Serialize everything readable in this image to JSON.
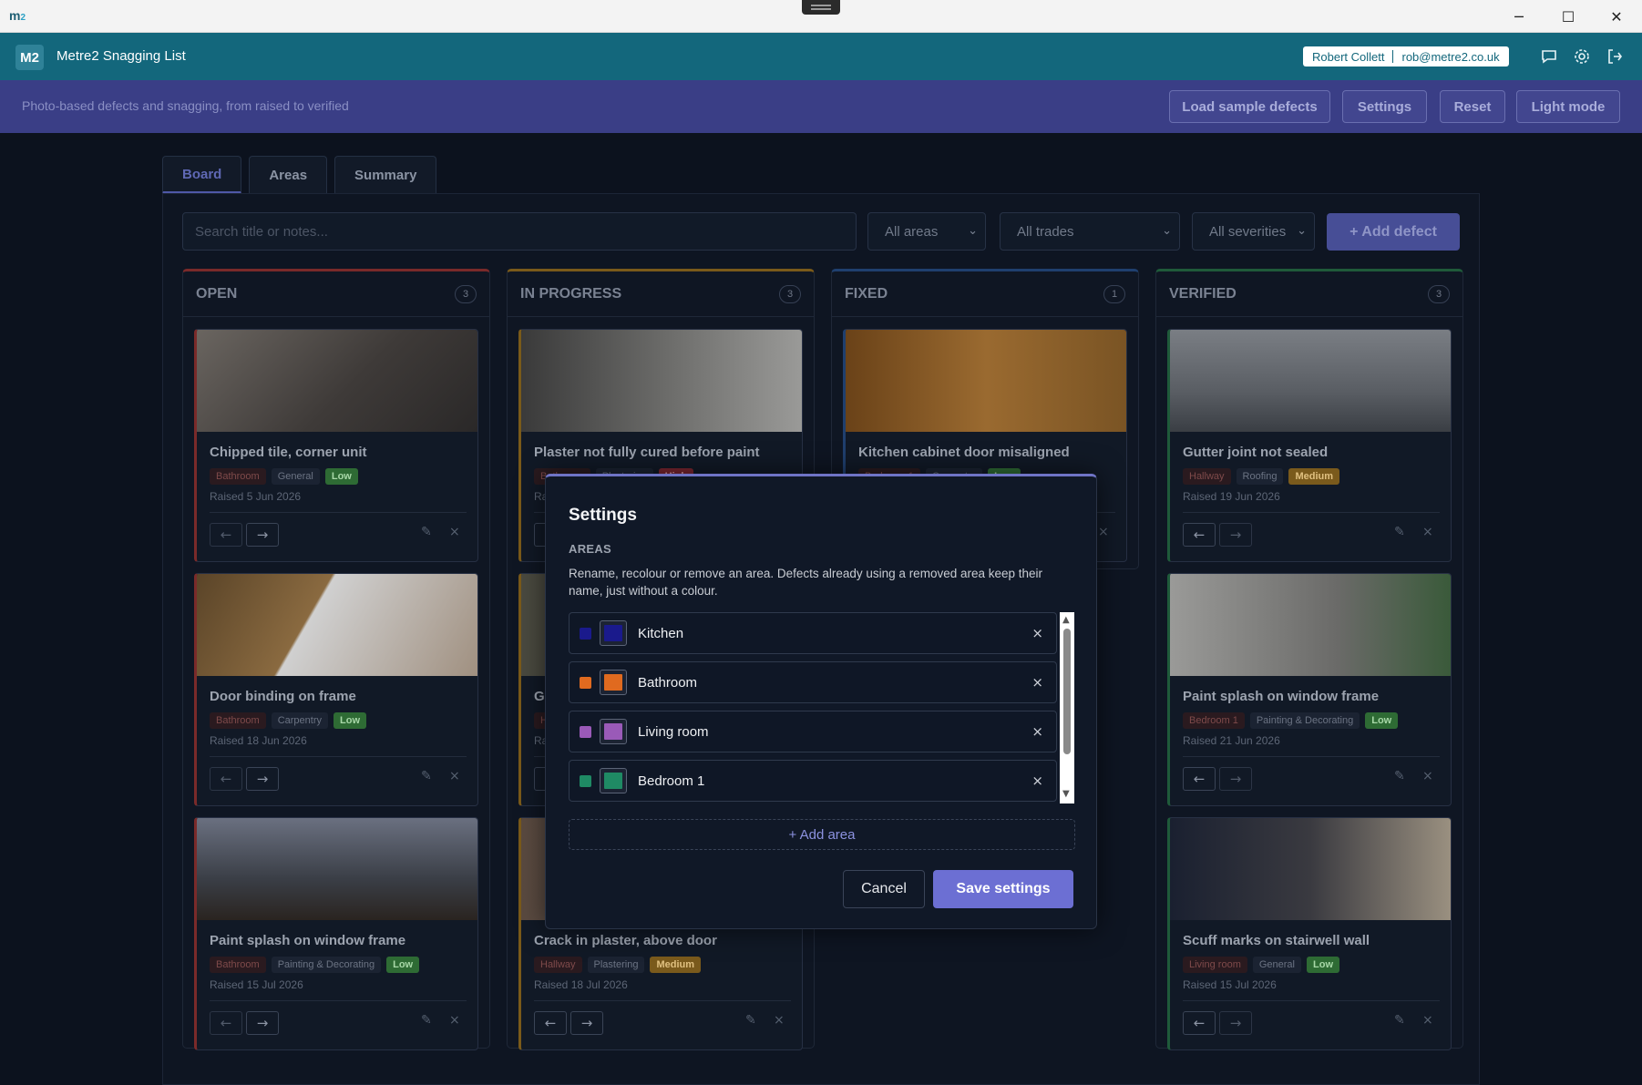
{
  "window": {
    "logo_main": "m",
    "logo_sub": "2",
    "min": "─",
    "max": "☐",
    "close": "✕"
  },
  "app": {
    "badge": "M2",
    "title": "Metre2 Snagging List",
    "user_name": "Robert Collett",
    "user_email": "rob@metre2.co.uk"
  },
  "subbar": {
    "tagline": "Photo-based defects and snagging, from raised to verified",
    "load_sample": "Load sample defects",
    "settings": "Settings",
    "reset": "Reset",
    "light_mode": "Light mode"
  },
  "tabs": [
    "Board",
    "Areas",
    "Summary"
  ],
  "filters": {
    "search_placeholder": "Search title or notes...",
    "areas": "All areas",
    "trades": "All trades",
    "severities": "All severities",
    "add_defect": "+ Add defect"
  },
  "columns": [
    {
      "name": "OPEN",
      "count": "3",
      "accent": "#7a2a2a",
      "cards": [
        {
          "title": "Chipped tile, corner unit",
          "area": "Bathroom",
          "trade": "General",
          "severity": "Low",
          "raised": "Raised 5 Jun 2026"
        },
        {
          "title": "Door binding on frame",
          "area": "Bathroom",
          "trade": "Carpentry",
          "severity": "Low",
          "raised": "Raised 18 Jun 2026"
        },
        {
          "title": "Paint splash on window frame",
          "area": "Bathroom",
          "trade": "Painting & Decorating",
          "severity": "Low",
          "raised": "Raised 15 Jul 2026"
        }
      ]
    },
    {
      "name": "IN PROGRESS",
      "count": "3",
      "accent": "#7a5a1a",
      "cards": [
        {
          "title": "Plaster not fully cured before paint",
          "area": "Bathroom",
          "trade": "Plastering",
          "severity": "High",
          "raised": "Raised"
        },
        {
          "title": "Gr",
          "area": "H",
          "trade": "",
          "severity": "",
          "raised": "Ra"
        },
        {
          "title": "Crack in plaster, above door",
          "area": "Hallway",
          "trade": "Plastering",
          "severity": "Medium",
          "raised": "Raised 18 Jul 2026"
        }
      ]
    },
    {
      "name": "FIXED",
      "count": "1",
      "accent": "#1f3f6e",
      "cards": [
        {
          "title": "Kitchen cabinet door misaligned",
          "area": "Bedroom 1",
          "trade": "Carpentry",
          "severity": "Low",
          "raised": ""
        }
      ]
    },
    {
      "name": "VERIFIED",
      "count": "3",
      "accent": "#1f5a3a",
      "cards": [
        {
          "title": "Gutter joint not sealed",
          "area": "Hallway",
          "trade": "Roofing",
          "severity": "Medium",
          "raised": "Raised 19 Jun 2026"
        },
        {
          "title": "Paint splash on window frame",
          "area": "Bedroom 1",
          "trade": "Painting & Decorating",
          "severity": "Low",
          "raised": "Raised 21 Jun 2026"
        },
        {
          "title": "Scuff marks on stairwell wall",
          "area": "Living room",
          "trade": "General",
          "severity": "Low",
          "raised": "Raised 15 Jul 2026"
        }
      ]
    }
  ],
  "card_actions": {
    "prev": "←",
    "next": "→",
    "edit": "✎",
    "delete": "×"
  },
  "settings_modal": {
    "title": "Settings",
    "section": "AREAS",
    "description": "Rename, recolour or remove an area. Defects already using a removed area keep their name, just without a colour.",
    "areas": [
      {
        "name": "Kitchen",
        "color": "#1a1a8c"
      },
      {
        "name": "Bathroom",
        "color": "#e06a1f"
      },
      {
        "name": "Living room",
        "color": "#9a5ab8"
      },
      {
        "name": "Bedroom 1",
        "color": "#1f8a64"
      }
    ],
    "remove": "×",
    "add_area": "+ Add area",
    "cancel": "Cancel",
    "save": "Save settings"
  }
}
